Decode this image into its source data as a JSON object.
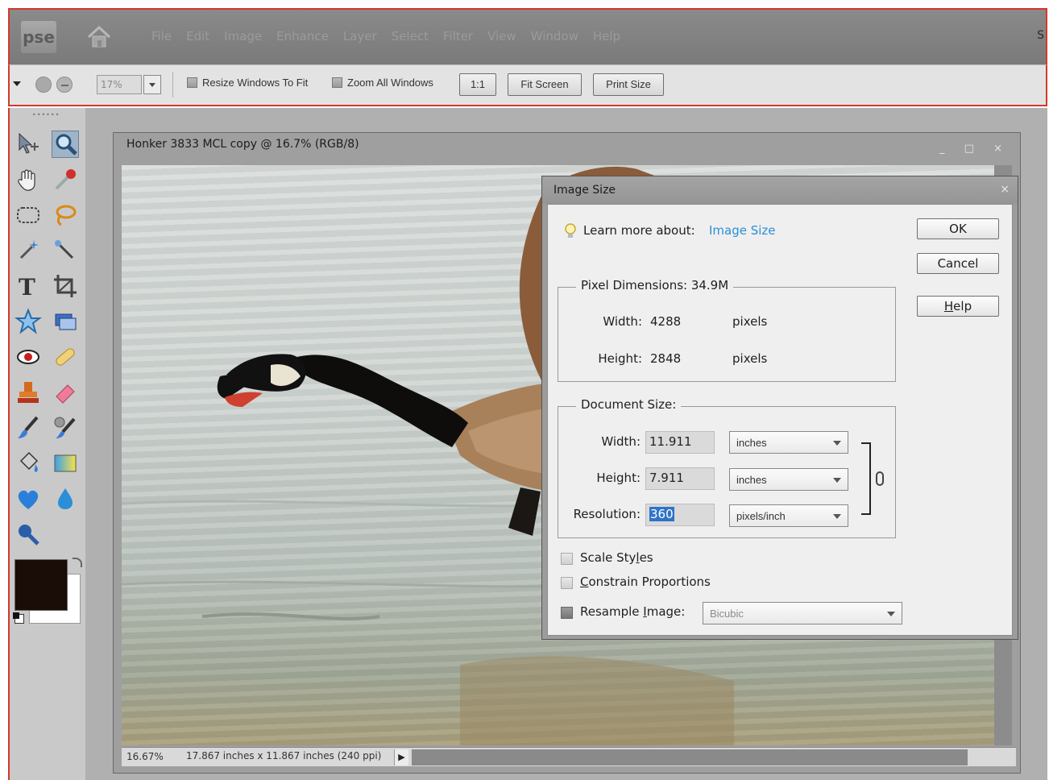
{
  "app": {
    "logo": "pse",
    "menu": [
      "File",
      "Edit",
      "Image",
      "Enhance",
      "Layer",
      "Select",
      "Filter",
      "View",
      "Window",
      "Help"
    ],
    "right_edge_char": "S"
  },
  "options_bar": {
    "zoom_value": "17%",
    "resize_windows_label": "Resize Windows To Fit",
    "zoom_all_label": "Zoom All Windows",
    "btn_1to1": "1:1",
    "btn_fit_screen": "Fit Screen",
    "btn_print_size": "Print Size"
  },
  "document": {
    "title": "Honker 3833 MCL copy @ 16.7% (RGB/8)",
    "window_controls": "_ □ ×",
    "zoom_pct": "16.67%",
    "info": "17.867 inches x 11.867 inches (240 ppi)",
    "status_arrow": "▶"
  },
  "toolbox": {
    "grip": "••••••"
  },
  "dialog": {
    "title": "Image Size",
    "close": "×",
    "learn_more_prefix": "Learn more about:",
    "learn_more_link": "Image Size",
    "ok": "OK",
    "cancel": "Cancel",
    "help_u": "H",
    "help_rest": "elp",
    "pixel_dimensions_title": "Pixel Dimensions:  34.9M",
    "px_width_label": "Width:",
    "px_width_value": "4288",
    "px_width_unit": "pixels",
    "px_height_label": "Height:",
    "px_height_value": "2848",
    "px_height_unit": "pixels",
    "document_size_title": "Document Size:",
    "doc_width_label": "Width:",
    "doc_width_value": "11.911",
    "doc_width_unit": "inches",
    "doc_height_label": "Height:",
    "doc_height_value": "7.911",
    "doc_height_unit": "inches",
    "resolution_label": "Resolution:",
    "resolution_value": "360",
    "resolution_unit": "pixels/inch",
    "scale_styles_a": "Scale Sty",
    "scale_styles_u": "l",
    "scale_styles_b": "es",
    "constrain_u": "C",
    "constrain_rest": "onstrain Proportions",
    "resample_a": "Resample ",
    "resample_u": "I",
    "resample_b": "mage:",
    "resample_method": "Bicubic"
  },
  "colors": {
    "frame_red": "#d23a2a",
    "link_blue": "#2a8fd8",
    "selection_blue": "#2f74c9",
    "foreground_swatch": "#1a0c06",
    "background_swatch": "#ffffff"
  }
}
